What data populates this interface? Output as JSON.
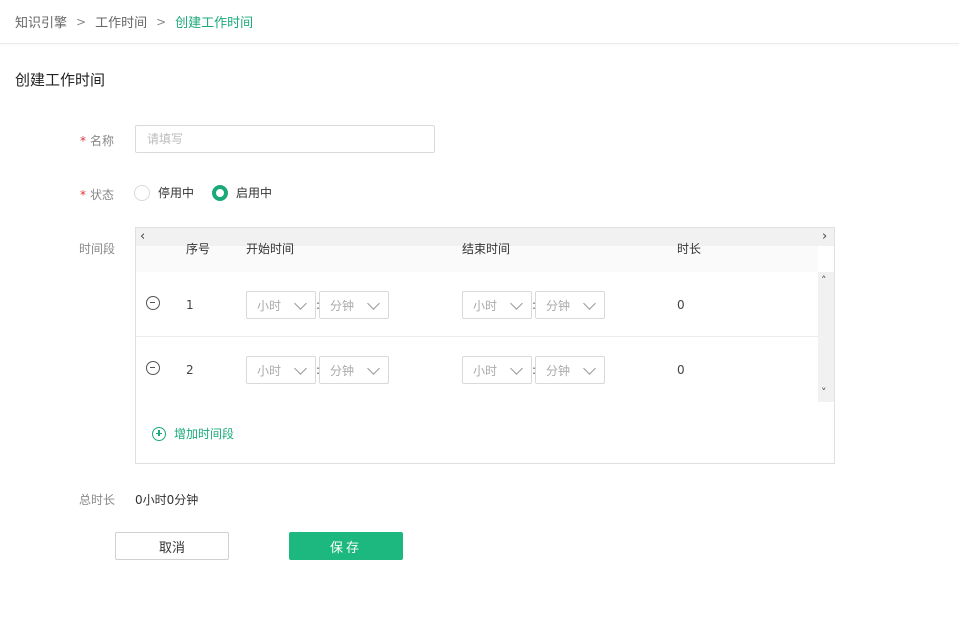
{
  "breadcrumb": {
    "items": [
      "知识引擎",
      "工作时间",
      "创建工作时间"
    ],
    "separator": ">"
  },
  "page_title": "创建工作时间",
  "form": {
    "name": {
      "label": "名称",
      "placeholder": "请填写",
      "value": ""
    },
    "status": {
      "label": "状态",
      "options": [
        "停用中",
        "启用中"
      ],
      "selected": "启用中"
    },
    "time_segments": {
      "label": "时间段",
      "columns": [
        "序号",
        "开始时间",
        "结束时间",
        "时长"
      ],
      "hour_placeholder": "小时",
      "minute_placeholder": "分钟",
      "colon": ":",
      "rows": [
        {
          "index": "1",
          "duration": "0"
        },
        {
          "index": "2",
          "duration": "0"
        }
      ],
      "add_label": "增加时间段"
    },
    "total": {
      "label": "总时长",
      "value": "0小时0分钟"
    }
  },
  "buttons": {
    "cancel": "取消",
    "save": "保存"
  },
  "colors": {
    "accent": "#1db87f",
    "required": "#d9363e"
  }
}
